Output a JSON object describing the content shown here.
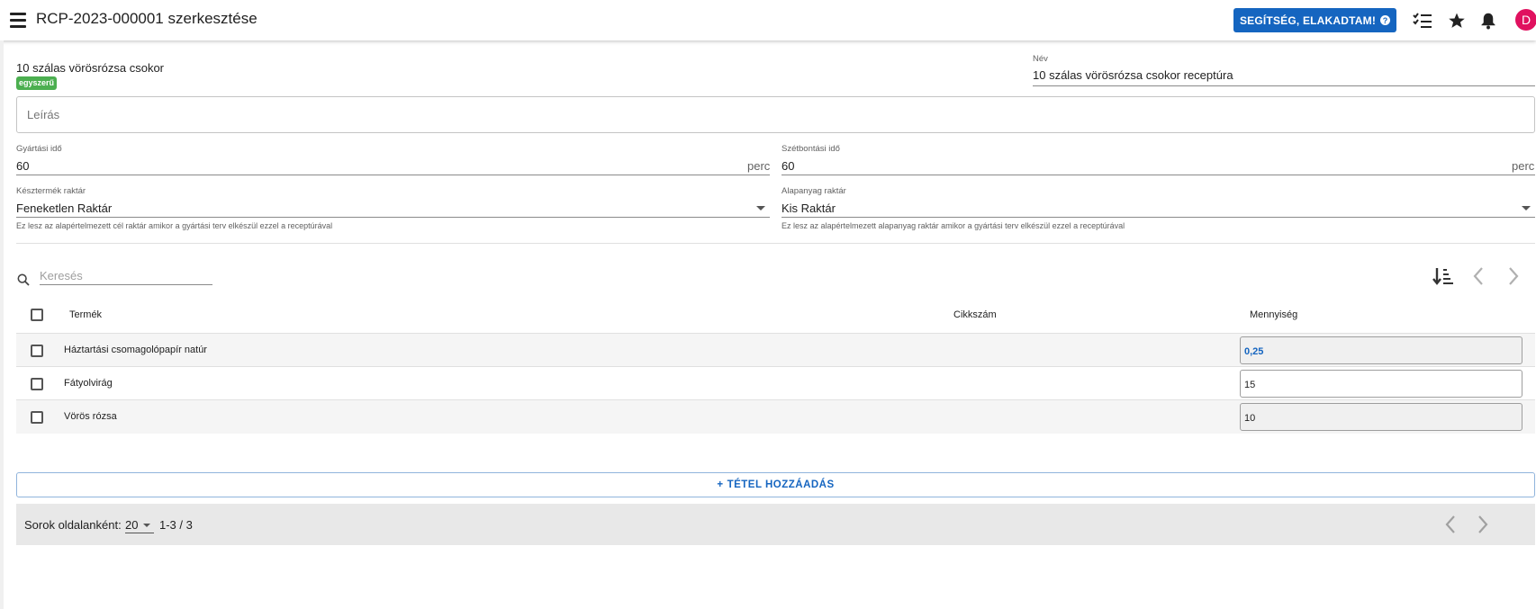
{
  "header": {
    "title": "RCP-2023-000001 szerkesztése",
    "help_button": "SEGÍTSÉG, ELAKADTAM!",
    "help_icon_glyph": "?",
    "avatar_letter": "D",
    "icons": [
      "menu-icon",
      "checklist-icon",
      "star-icon",
      "bell-icon"
    ],
    "accent_color": "#1565c0"
  },
  "product": {
    "name": "10 szálas vörösrózsa csokor",
    "type_badge": "egyszerű"
  },
  "form": {
    "name_label": "Név",
    "name_value": "10 szálas vörösrózsa csokor receptúra",
    "description_placeholder": "Leírás",
    "production_time_label": "Gyártási idő",
    "production_time_value": "60",
    "production_time_unit": "perc",
    "disassembly_time_label": "Szétbontási idő",
    "disassembly_time_value": "60",
    "disassembly_time_unit": "perc",
    "finished_warehouse_label": "Késztermék raktár",
    "finished_warehouse_value": "Feneketlen Raktár",
    "finished_warehouse_hint": "Ez lesz az alapértelmezett cél raktár amikor a gyártási terv elkészül ezzel a receptúrával",
    "raw_warehouse_label": "Alapanyag raktár",
    "raw_warehouse_value": "Kis Raktár",
    "raw_warehouse_hint": "Ez lesz az alapértelmezett alapanyag raktár amikor a gyártási terv elkészül ezzel a receptúrával"
  },
  "table": {
    "search_placeholder": "Keresés",
    "columns": [
      "Termék",
      "Cikkszám",
      "Mennyiség"
    ],
    "rows": [
      {
        "product": "Háztartási csomagolópapír natúr",
        "sku": "",
        "quantity": "0,25"
      },
      {
        "product": "Fátyolvirág",
        "sku": "",
        "quantity": "15"
      },
      {
        "product": "Vörös rózsa",
        "sku": "",
        "quantity": "10"
      }
    ],
    "add_button": "TÉTEL HOZZÁADÁS",
    "add_icon_glyph": "+"
  },
  "pagination": {
    "rows_per_page_label": "Sorok oldalanként:",
    "rows_per_page_value": "20",
    "range": "1-3 / 3"
  },
  "badge_color": "#4caf50"
}
